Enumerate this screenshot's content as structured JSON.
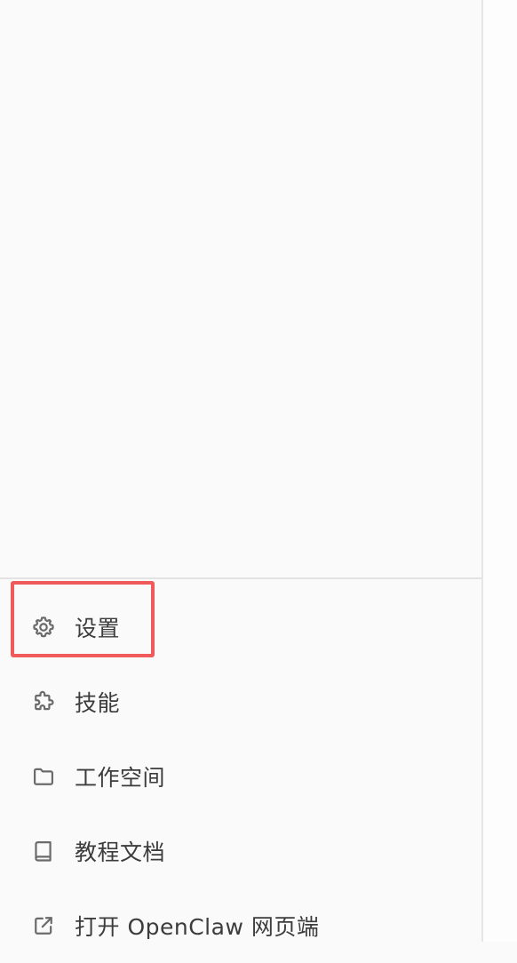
{
  "sidebar": {
    "items": [
      {
        "label": "设置",
        "icon": "gear-icon"
      },
      {
        "label": "技能",
        "icon": "puzzle-icon"
      },
      {
        "label": "工作空间",
        "icon": "folder-icon"
      },
      {
        "label": "教程文档",
        "icon": "book-icon"
      },
      {
        "label": "打开 OpenClaw 网页端",
        "icon": "external-link-icon"
      }
    ]
  },
  "highlight": {
    "target": "设置",
    "color": "#f05a5a"
  },
  "colors": {
    "sidebar_background": "#fafafa",
    "icon": "#6b6b6b",
    "text": "#3c3c3c",
    "divider": "#e3e3e3"
  }
}
